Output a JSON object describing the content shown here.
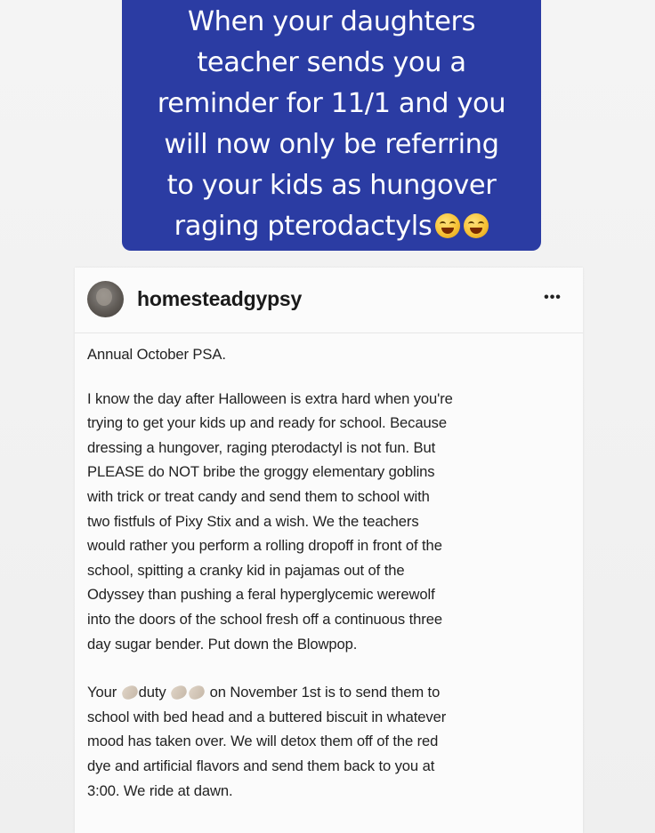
{
  "caption": {
    "text": "When your daughters\nteacher sends you a\nreminder for 11/1 and you\nwill now only be referring\nto your kids as hungover\nraging pterodactyls",
    "emoji_icons": [
      "tears-of-joy-emoji",
      "rofl-emoji"
    ]
  },
  "post": {
    "username": "homesteadgypsy",
    "more_label": "•••",
    "intro": "Annual October PSA.",
    "body": "I know the day after Halloween is extra hard when you're\ntrying to get your kids up and ready for school. Because\ndressing a hungover, raging pterodactyl is not fun. But\nPLEASE do NOT bribe the groggy elementary goblins\nwith trick or treat candy and send them to school with\ntwo fistfuls of Pixy Stix and a wish. We the teachers\nwould rather you perform a rolling dropoff in front of the\nschool, spitting a cranky kid in pajamas out of the\nOdyssey than pushing a feral hyperglycemic werewolf\ninto the doors of the school fresh off a continuous three\nday sugar bender. Put down the Blowpop.",
    "duty_prefix": "Your",
    "duty_word": "duty",
    "duty_rest": " on November 1st is to send them to\nschool with bed head and a buttered biscuit in whatever\nmood has taken over. We will detox them off of the red\ndye and artificial flavors and send them back to you at\n3:00. We ride at dawn.",
    "clap_icons": [
      "clapping-hands-emoji"
    ]
  },
  "colors": {
    "caption_bg": "#2b3ca3",
    "caption_text": "#ffffff",
    "post_bg": "#fbfbfb",
    "post_text": "#222222"
  }
}
